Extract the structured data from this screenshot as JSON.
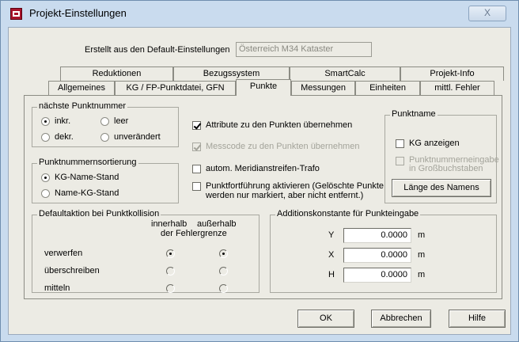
{
  "window": {
    "title": "Projekt-Einstellungen",
    "close_label": "X"
  },
  "header": {
    "label": "Erstellt aus den Default-Einstellungen",
    "value": "Österreich M34 Kataster"
  },
  "tabs_row1": [
    "Reduktionen",
    "Bezugssystem",
    "SmartCalc",
    "Projekt-Info"
  ],
  "tabs_row2": [
    "Allgemeines",
    "KG / FP-Punktdatei, GFN",
    "Punkte",
    "Messungen",
    "Einheiten",
    "mittl. Fehler"
  ],
  "active_tab": "Punkte",
  "naechste_punktnummer": {
    "legend": "nächste Punktnummer",
    "options": [
      "inkr.",
      "leer",
      "dekr.",
      "unverändert"
    ],
    "selected": "inkr."
  },
  "punktnummernsortierung": {
    "legend": "Punktnummernsortierung",
    "options": [
      "KG-Name-Stand",
      "Name-KG-Stand"
    ],
    "selected": "KG-Name-Stand"
  },
  "checks": {
    "attribute": "Attribute zu den Punkten übernehmen",
    "messcode": "Messcode zu den Punkten übernehmen",
    "meridian": "autom. Meridianstreifen-Trafo",
    "fortfuehrung_line1": "Punktfortführung aktivieren (Gelöschte Punkte",
    "fortfuehrung_line2": "werden nur markiert, aber nicht entfernt.)"
  },
  "punktname": {
    "legend": "Punktname",
    "kg_anzeigen": "KG anzeigen",
    "gross_line1": "Punktnummerneingabe",
    "gross_line2": "in Großbuchstaben",
    "laenge_button": "Länge des Namens"
  },
  "kollision": {
    "legend": "Defaultaktion bei Punktkollision",
    "col_innerhalb": "innerhalb",
    "col_ausserhalb": "außerhalb",
    "col_sub": "der Fehlergrenze",
    "rows": [
      "verwerfen",
      "überschreiben",
      "mitteln"
    ]
  },
  "additionskonstante": {
    "legend": "Additionskonstante für Punkteingabe",
    "rows": [
      {
        "label": "Y",
        "value": "0.0000",
        "unit": "m"
      },
      {
        "label": "X",
        "value": "0.0000",
        "unit": "m"
      },
      {
        "label": "H",
        "value": "0.0000",
        "unit": "m"
      }
    ]
  },
  "buttons": {
    "ok": "OK",
    "abbrechen": "Abbrechen",
    "hilfe": "Hilfe"
  }
}
